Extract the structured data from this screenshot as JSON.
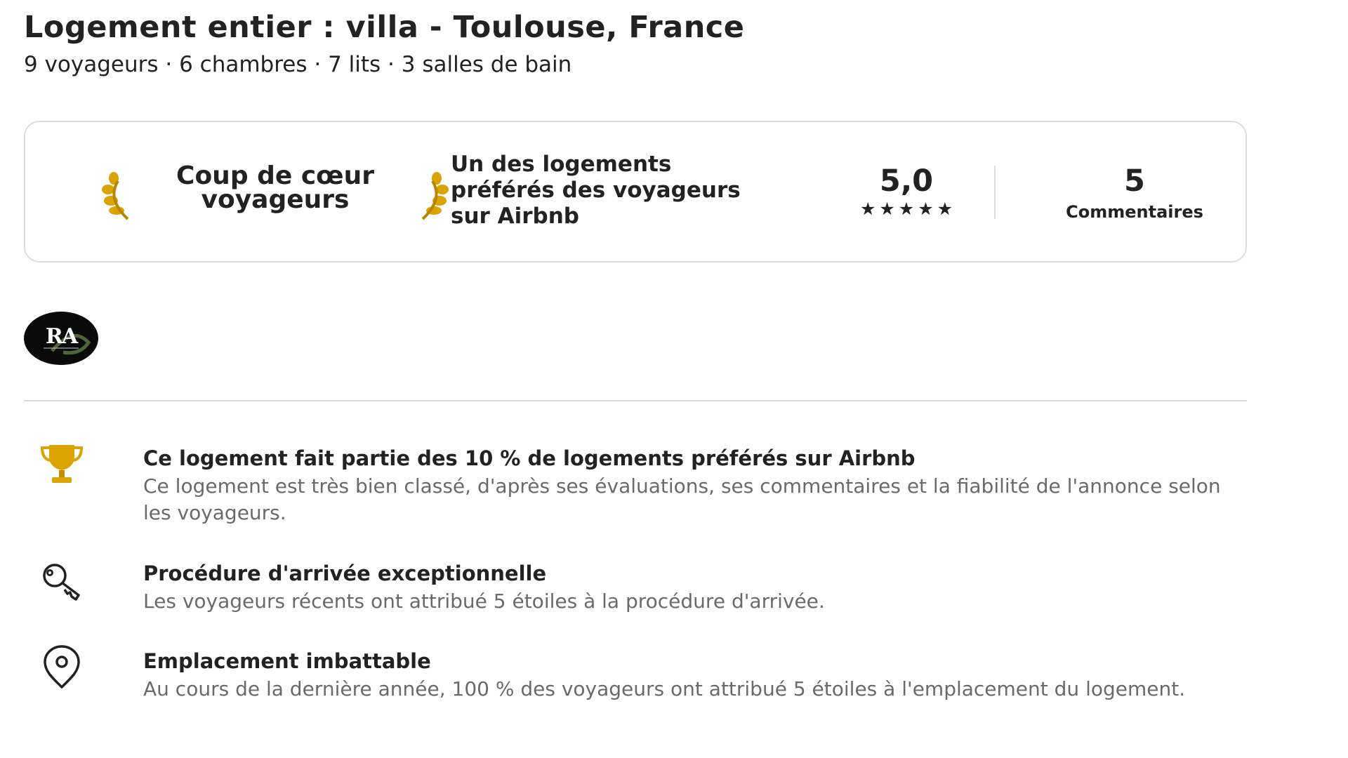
{
  "listing": {
    "title": "Logement entier : villa - Toulouse, France",
    "summary": "9 voyageurs · 6 chambres · 7 lits · 3 salles de bain"
  },
  "guest_favorite": {
    "badge_line1": "Coup de cœur",
    "badge_line2": "voyageurs",
    "description_line1": "Un des logements",
    "description_line2": "préférés des voyageurs",
    "description_line3": "sur Airbnb",
    "rating": "5,0",
    "stars": 5,
    "reviews_count": "5",
    "reviews_label": "Commentaires"
  },
  "host": {
    "avatar_text": "RA",
    "avatar_icon": "host-logo"
  },
  "highlights": [
    {
      "icon": "trophy-icon",
      "title": "Ce logement fait partie des 10 % de logements préférés sur Airbnb",
      "description": "Ce logement est très bien classé, d'après ses évaluations, ses commentaires et la fiabilité de l'annonce selon les voyageurs."
    },
    {
      "icon": "key-icon",
      "title": "Procédure d'arrivée exceptionnelle",
      "description": "Les voyageurs récents ont attribué 5 étoiles à la procédure d'arrivée."
    },
    {
      "icon": "map-pin-icon",
      "title": "Emplacement imbattable",
      "description": "Au cours de la dernière année, 100 % des voyageurs ont attribué 5 étoiles à l'emplacement du logement."
    }
  ],
  "colors": {
    "text_primary": "#222222",
    "text_secondary": "#6a6a6a",
    "border": "#dddddd",
    "laurel_gold": "#d9a300"
  }
}
